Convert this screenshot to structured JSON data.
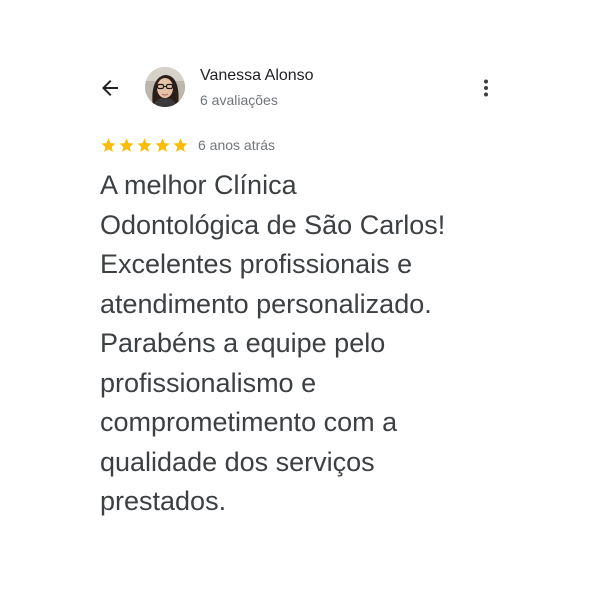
{
  "header": {
    "back_icon": "arrow-left-icon",
    "more_icon": "more-vert-icon"
  },
  "reviewer": {
    "name": "Vanessa Alonso",
    "review_count": "6 avaliações",
    "avatar": "avatar-photo"
  },
  "review": {
    "rating": 5,
    "max_rating": 5,
    "star_color": "#fbbc04",
    "time_ago": "6 anos atrás",
    "text_lines": [
      "A melhor Clínica",
      "Odontológica de São Carlos!",
      "Excelentes profissionais e",
      "atendimento personalizado.",
      "Parabéns a equipe pelo",
      "profissionalismo e",
      "comprometimento com a",
      "qualidade dos serviços",
      "prestados."
    ]
  }
}
